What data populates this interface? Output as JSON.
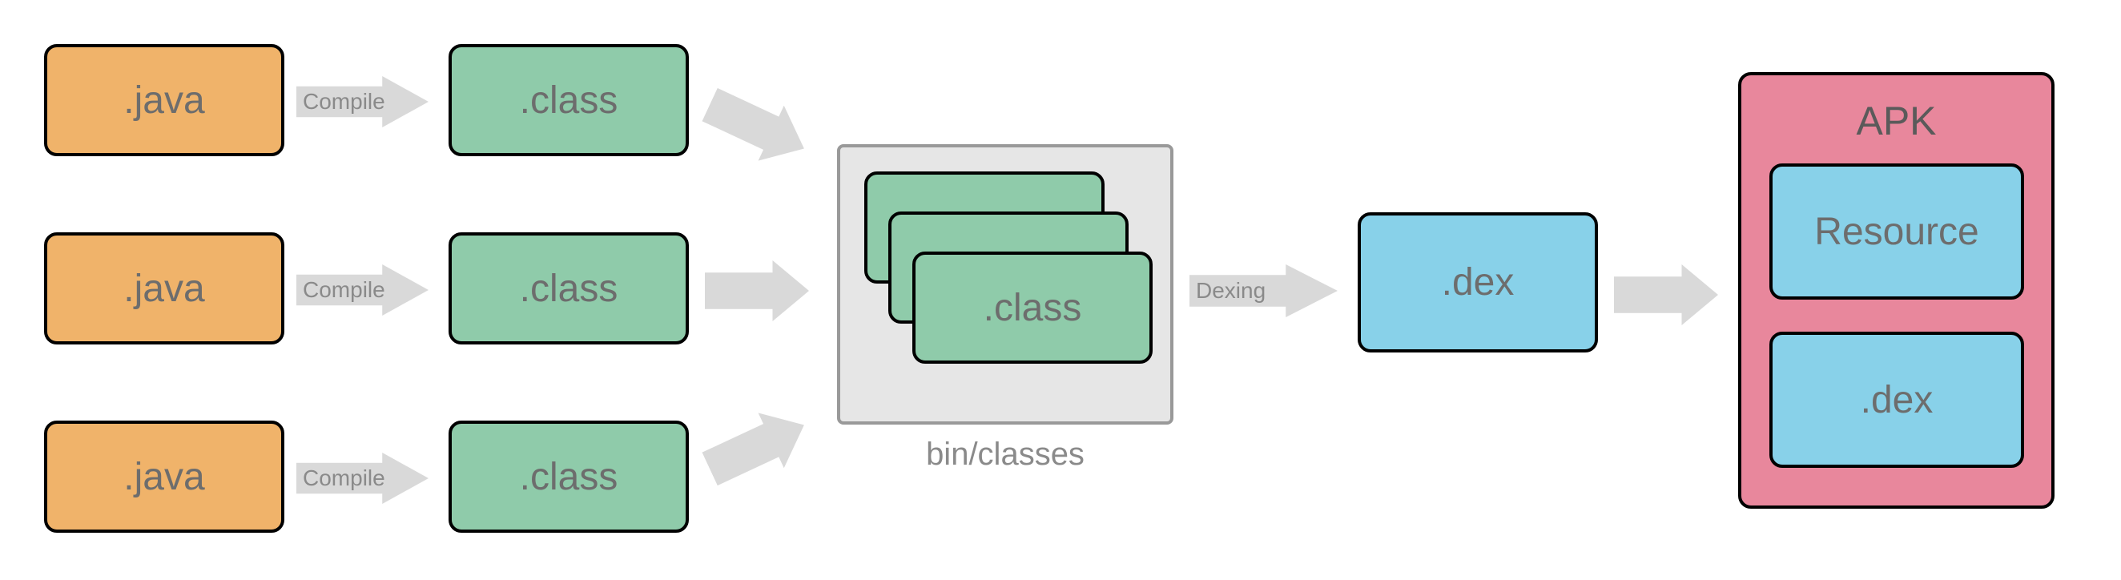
{
  "diagram": {
    "java": [
      ".java",
      ".java",
      ".java"
    ],
    "compile_label": "Compile",
    "class": [
      ".class",
      ".class",
      ".class"
    ],
    "bin": {
      "caption": "bin/classes",
      "stack_label": ".class"
    },
    "dexing_label": "Dexing",
    "dex_label": ".dex",
    "apk": {
      "title": "APK",
      "resource_label": "Resource",
      "dex_label": ".dex"
    },
    "colors": {
      "orange": "#f0b36a",
      "green": "#8fcbaa",
      "gray": "#e6e6e6",
      "blue": "#88d1e9",
      "pink": "#e8879c",
      "arrow": "#d9d9d9"
    }
  }
}
